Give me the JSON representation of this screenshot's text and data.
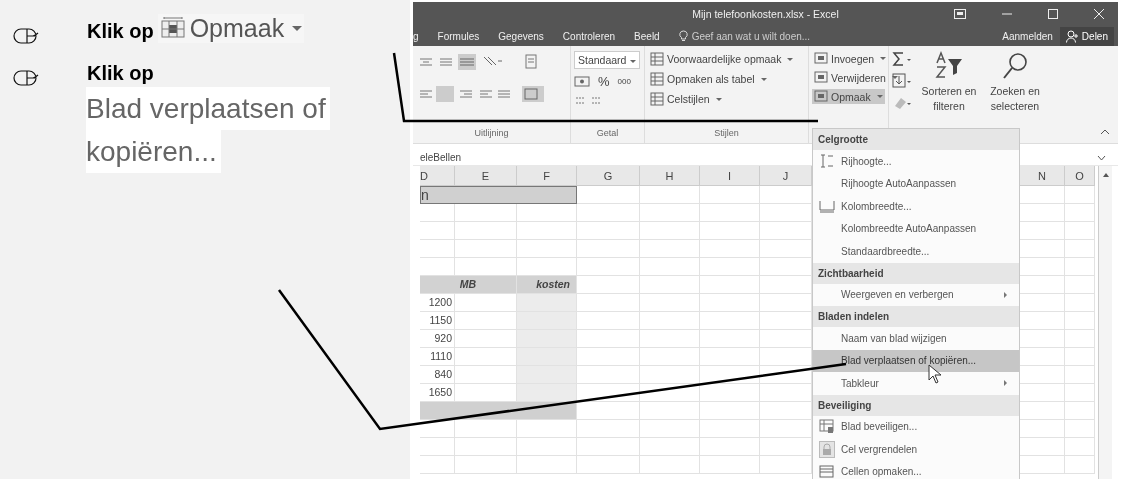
{
  "instructions": [
    {
      "kind": "click",
      "label": "Klik op",
      "target": {
        "kind": "button",
        "lines": [
          "Opmaak"
        ]
      }
    },
    {
      "kind": "click",
      "label": "Klik op",
      "target": {
        "kind": "menu_item",
        "lines": [
          "Blad verplaatsen of",
          "kopiëren..."
        ]
      }
    }
  ],
  "excel": {
    "title": "Mijn telefoonkosten.xlsx - Excel",
    "ribbon_tabs": [
      {
        "label": "g",
        "selected": false
      },
      {
        "label": "Formules",
        "selected": false
      },
      {
        "label": "Gegevens",
        "selected": false
      },
      {
        "label": "Controleren",
        "selected": false
      },
      {
        "label": "Beeld",
        "selected": false
      }
    ],
    "tell_me": "Geef aan wat u wilt doen...",
    "sign_in": "Aanmelden",
    "share": "Delen",
    "ribbon": {
      "alignment_label": "Uitlijning",
      "number_format": "Standaard",
      "percent": "%",
      "thousands": "000",
      "number_label": "Getal",
      "styles": [
        "Voorwaardelijke opmaak",
        "Opmaken als tabel",
        "Celstijlen"
      ],
      "styles_label": "Stijlen",
      "cells": [
        {
          "label": "Invoegen",
          "selected": false
        },
        {
          "label": "Verwijderen",
          "selected": false
        },
        {
          "label": "Opmaak",
          "selected": true
        }
      ],
      "sort": "Sorteren en filteren",
      "find": "Zoeken en selecteren"
    },
    "formula_bar": "eleBellen",
    "columns": [
      "D",
      "E",
      "F",
      "G",
      "H",
      "I",
      "J",
      "N",
      "O"
    ],
    "rows": [
      {
        "kind": "title",
        "text": "n"
      },
      {
        "kind": "empty"
      },
      {
        "kind": "empty"
      },
      {
        "kind": "empty"
      },
      {
        "kind": "empty"
      },
      {
        "kind": "header",
        "cells": [
          "MB",
          "kosten"
        ]
      },
      {
        "kind": "data",
        "value": "1200"
      },
      {
        "kind": "data",
        "value": "1150"
      },
      {
        "kind": "data",
        "value": "920"
      },
      {
        "kind": "data",
        "value": "1110"
      },
      {
        "kind": "data",
        "value": "840"
      },
      {
        "kind": "data",
        "value": "1650"
      },
      {
        "kind": "total"
      },
      {
        "kind": "empty"
      },
      {
        "kind": "empty"
      },
      {
        "kind": "empty"
      }
    ],
    "menu": [
      {
        "kind": "header",
        "label": "Celgrootte"
      },
      {
        "kind": "icon_item",
        "label": "Rijhoogte...",
        "selected": false,
        "submenu": false
      },
      {
        "kind": "item",
        "label": "Rijhoogte AutoAanpassen",
        "selected": false,
        "submenu": false
      },
      {
        "kind": "icon_item",
        "label": "Kolombreedte...",
        "selected": false,
        "submenu": false
      },
      {
        "kind": "item",
        "label": "Kolombreedte AutoAanpassen",
        "selected": false,
        "submenu": false
      },
      {
        "kind": "item",
        "label": "Standaardbreedte...",
        "selected": false,
        "submenu": false
      },
      {
        "kind": "header",
        "label": "Zichtbaarheid"
      },
      {
        "kind": "item",
        "label": "Weergeven en verbergen",
        "selected": false,
        "submenu": true
      },
      {
        "kind": "header",
        "label": "Bladen indelen"
      },
      {
        "kind": "item",
        "label": "Naam van blad wijzigen",
        "selected": false,
        "submenu": false
      },
      {
        "kind": "item",
        "label": "Blad verplaatsen of kopiëren...",
        "selected": true,
        "submenu": false
      },
      {
        "kind": "item",
        "label": "Tabkleur",
        "selected": false,
        "submenu": true
      },
      {
        "kind": "header",
        "label": "Beveiliging"
      },
      {
        "kind": "icon_item",
        "label": "Blad beveiligen...",
        "selected": false,
        "submenu": false
      },
      {
        "kind": "icon_item",
        "label": "Cel vergrendelen",
        "selected": false,
        "submenu": false
      },
      {
        "kind": "icon_item",
        "label": "Cellen opmaken...",
        "selected": false,
        "submenu": false
      }
    ]
  }
}
